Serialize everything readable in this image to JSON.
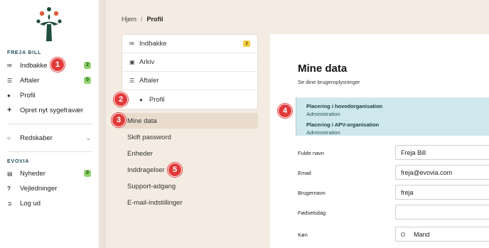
{
  "nav": {
    "section1": "FREJA BILL",
    "items1": [
      {
        "label": "Indbakke",
        "icon": "inbox-icon",
        "badge": "2"
      },
      {
        "label": "Aftaler",
        "icon": "list-icon",
        "badge": "0"
      },
      {
        "label": "Profil",
        "icon": "user-icon"
      },
      {
        "label": "Opret nyt sygefravær",
        "icon": "plus-icon"
      }
    ],
    "tools": {
      "label": "Redskaber",
      "icon": "chat-icon"
    },
    "section2": "EVOVIA",
    "items2": [
      {
        "label": "Nyheder",
        "icon": "news-icon",
        "badge": "0"
      },
      {
        "label": "Vejledninger",
        "icon": "question-icon"
      },
      {
        "label": "Log ud",
        "icon": "logout-icon"
      }
    ]
  },
  "breadcrumb": {
    "home": "Hjem",
    "sep": "/",
    "current": "Profil"
  },
  "submenu": [
    {
      "label": "Indbakke",
      "icon": "inbox-icon",
      "badge": "2"
    },
    {
      "label": "Arkiv",
      "icon": "archive-icon"
    },
    {
      "label": "Aftaler",
      "icon": "list-icon"
    },
    {
      "label": "Profil",
      "icon": "user-icon"
    }
  ],
  "links": [
    "Mine data",
    "Skift password",
    "Enheder",
    "Inddragelser",
    "Support-adgang",
    "E-mail-indstillinger"
  ],
  "content": {
    "title": "Mine data",
    "subtitle": "Se dine brugeroplysninger",
    "info": [
      {
        "title": "Placering i hovedorganisation",
        "value": "Administration"
      },
      {
        "title": "Placering i APV-organisation",
        "value": "Administration"
      }
    ],
    "fields": [
      {
        "label": "Fulde navn",
        "value": "Freja Bill"
      },
      {
        "label": "Email",
        "value": "freja@evovia.com"
      },
      {
        "label": "Brugernavn",
        "value": "freja"
      },
      {
        "label": "Fødselsdag",
        "value": ""
      }
    ],
    "gender": {
      "label": "Køn",
      "option": "Mand"
    }
  },
  "callouts": [
    "1",
    "2",
    "3",
    "4",
    "5"
  ],
  "colors": {
    "accent": "#e23a3a",
    "active_bg": "#e9dccd",
    "info_bg": "#cfe8ed",
    "badge_green": "#8fd46b",
    "badge_yellow": "#f5cf45"
  }
}
